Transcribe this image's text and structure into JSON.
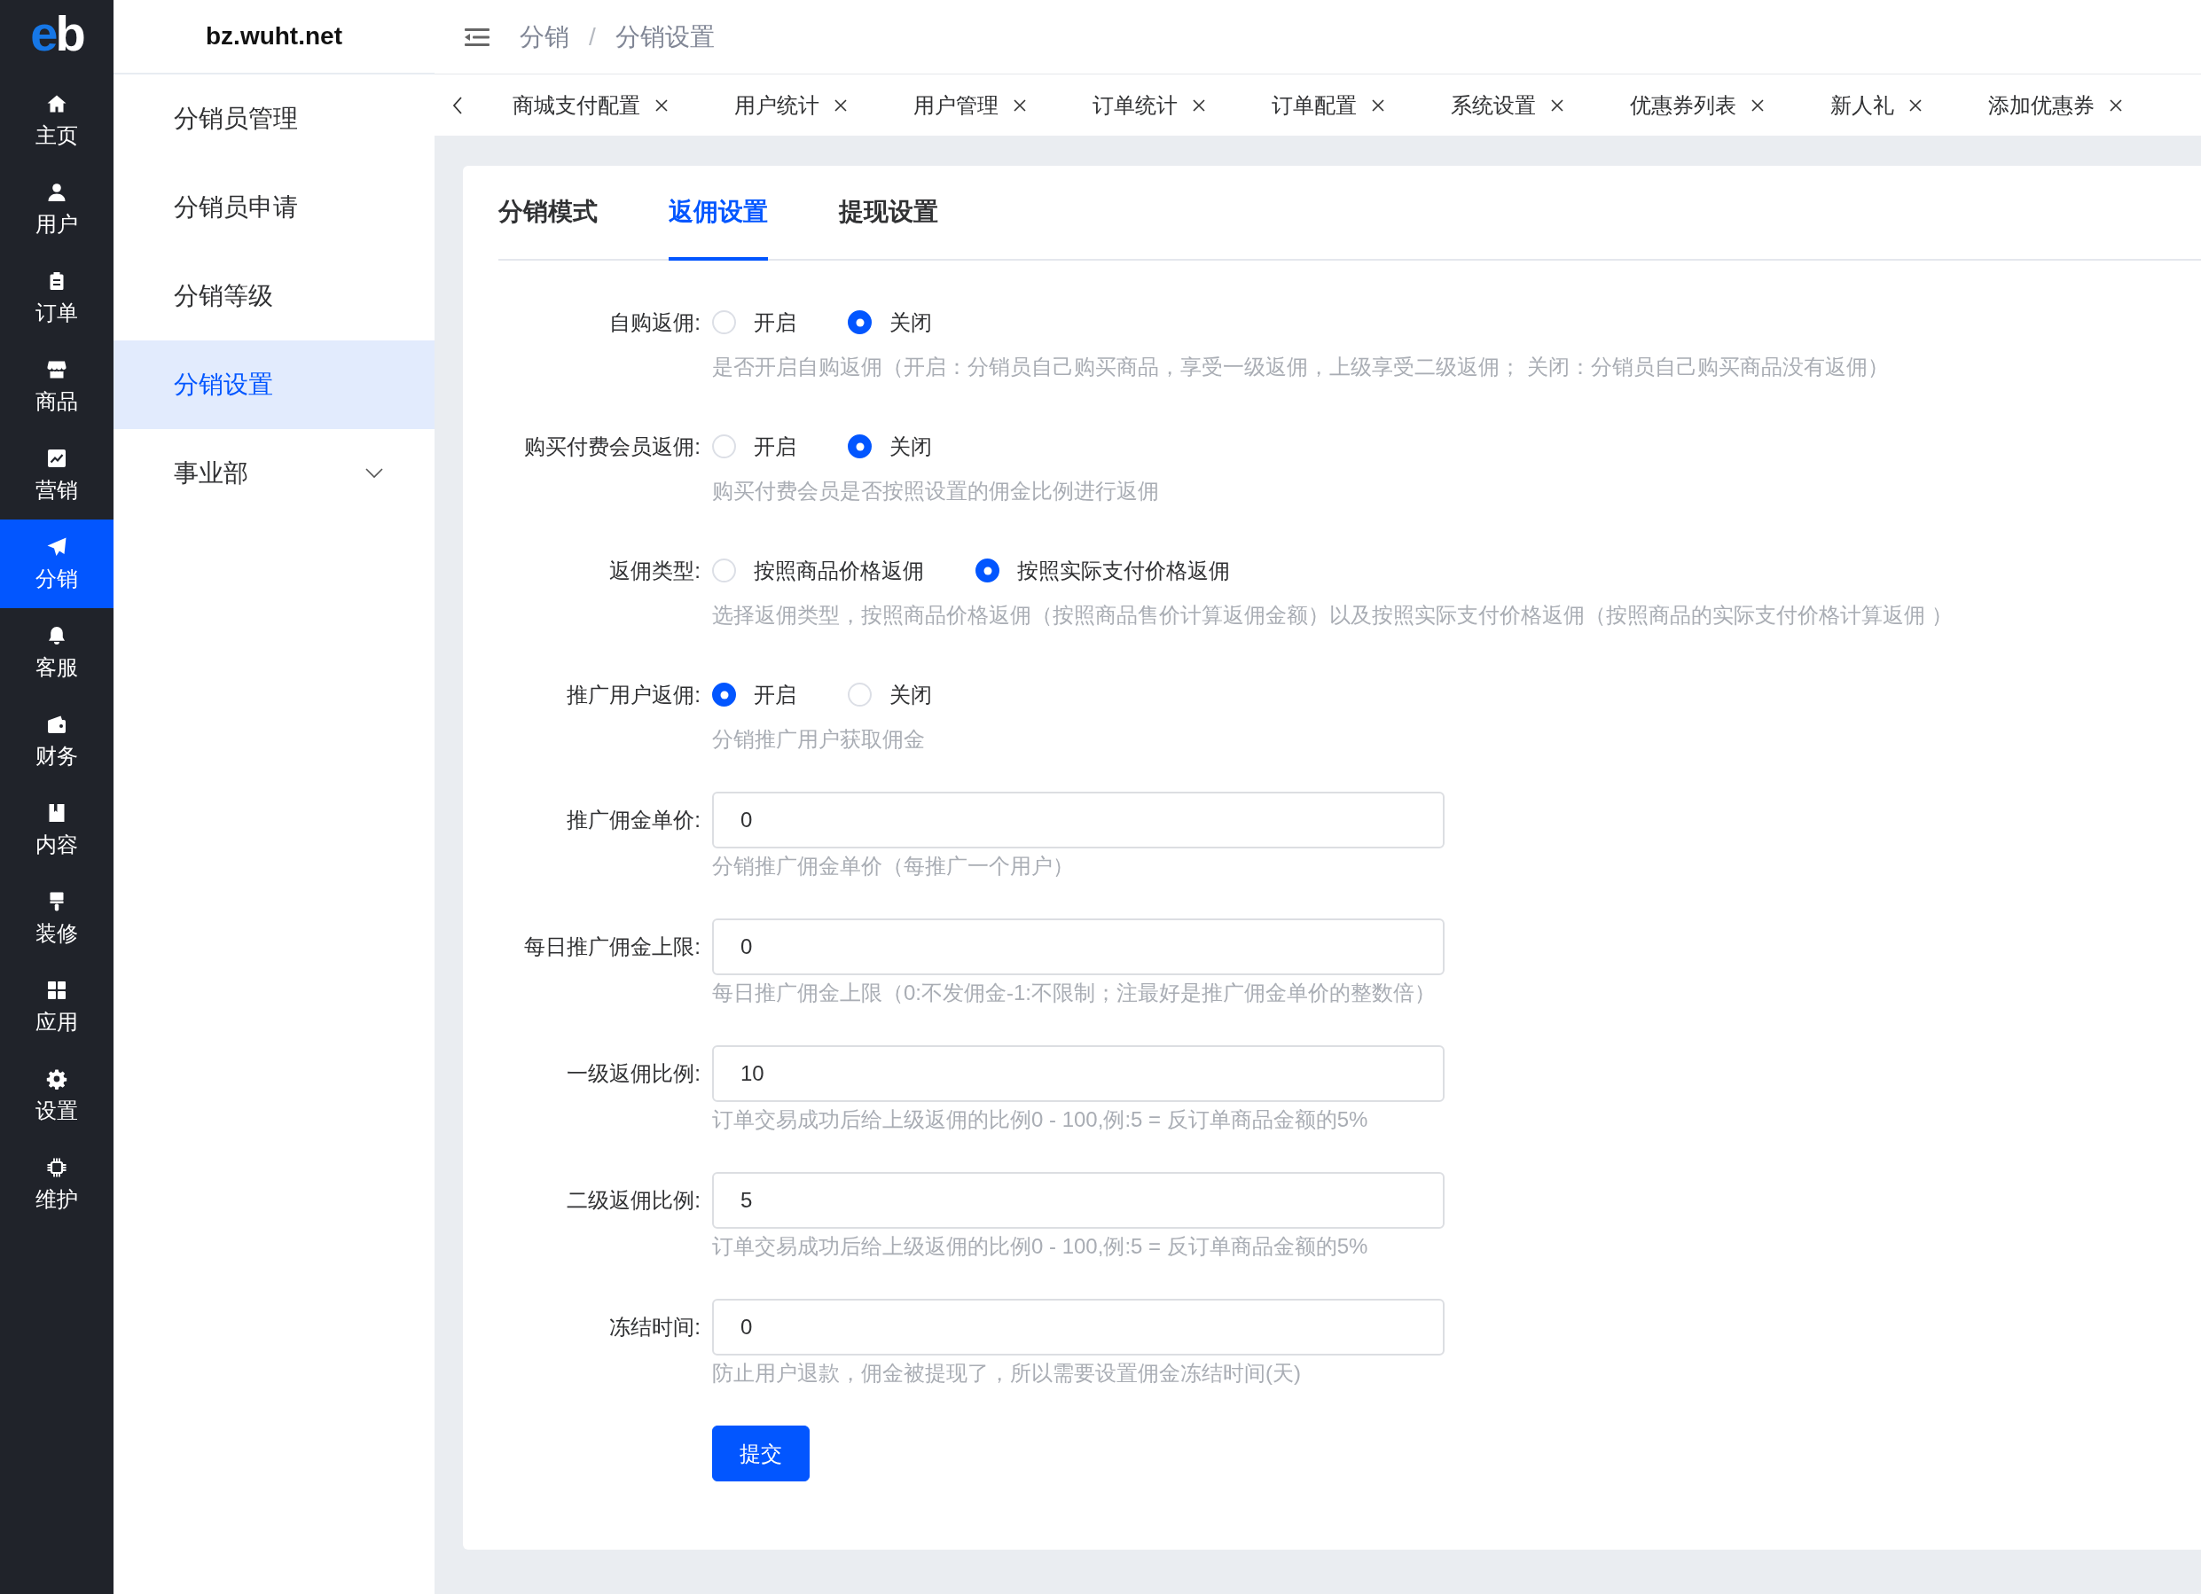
{
  "nav_rail": {
    "logo": "eb",
    "items": [
      {
        "label": "主页",
        "selected": false
      },
      {
        "label": "用户",
        "selected": false
      },
      {
        "label": "订单",
        "selected": false
      },
      {
        "label": "商品",
        "selected": false
      },
      {
        "label": "营销",
        "selected": false
      },
      {
        "label": "分销",
        "selected": true
      },
      {
        "label": "客服",
        "selected": false
      },
      {
        "label": "财务",
        "selected": false
      },
      {
        "label": "内容",
        "selected": false
      },
      {
        "label": "装修",
        "selected": false
      },
      {
        "label": "应用",
        "selected": false
      },
      {
        "label": "设置",
        "selected": false
      },
      {
        "label": "维护",
        "selected": false
      }
    ]
  },
  "submenu": {
    "title": "bz.wuht.net",
    "items": [
      {
        "kind": "link",
        "label": "分销员管理",
        "selected": false
      },
      {
        "kind": "link",
        "label": "分销员申请",
        "selected": false
      },
      {
        "kind": "link",
        "label": "分销等级",
        "selected": false
      },
      {
        "kind": "link",
        "label": "分销设置",
        "selected": true
      },
      {
        "kind": "group",
        "label": "事业部",
        "selected": false,
        "expanded": false
      }
    ]
  },
  "header": {
    "breadcrumb": [
      "分销",
      "分销设置"
    ],
    "separator": "/"
  },
  "page_tabs": [
    {
      "label": "商城支付配置",
      "selected": false
    },
    {
      "label": "用户统计",
      "selected": false
    },
    {
      "label": "用户管理",
      "selected": false
    },
    {
      "label": "订单统计",
      "selected": false
    },
    {
      "label": "订单配置",
      "selected": false
    },
    {
      "label": "系统设置",
      "selected": false
    },
    {
      "label": "优惠券列表",
      "selected": false
    },
    {
      "label": "新人礼",
      "selected": false
    },
    {
      "label": "添加优惠券",
      "selected": false
    }
  ],
  "settings_tabs": [
    {
      "label": "分销模式",
      "selected": false
    },
    {
      "label": "返佣设置",
      "selected": true
    },
    {
      "label": "提现设置",
      "selected": false
    }
  ],
  "form": {
    "fields": [
      {
        "kind": "radio",
        "label": "自购返佣:",
        "options": [
          {
            "label": "开启",
            "selected": false
          },
          {
            "label": "关闭",
            "selected": true
          }
        ],
        "hint": "是否开启自购返佣（开启：分销员自己购买商品，享受一级返佣，上级享受二级返佣； 关闭：分销员自己购买商品没有返佣）"
      },
      {
        "kind": "radio",
        "label": "购买付费会员返佣:",
        "options": [
          {
            "label": "开启",
            "selected": false
          },
          {
            "label": "关闭",
            "selected": true
          }
        ],
        "hint": "购买付费会员是否按照设置的佣金比例进行返佣"
      },
      {
        "kind": "radio",
        "label": "返佣类型:",
        "options": [
          {
            "label": "按照商品价格返佣",
            "selected": false
          },
          {
            "label": "按照实际支付价格返佣",
            "selected": true
          }
        ],
        "hint": "选择返佣类型，按照商品价格返佣（按照商品售价计算返佣金额）以及按照实际支付价格返佣（按照商品的实际支付价格计算返佣 ）"
      },
      {
        "kind": "radio",
        "label": "推广用户返佣:",
        "options": [
          {
            "label": "开启",
            "selected": true
          },
          {
            "label": "关闭",
            "selected": false
          }
        ],
        "hint": "分销推广用户获取佣金"
      },
      {
        "kind": "input",
        "label": "推广佣金单价:",
        "value": "0",
        "hint": "分销推广佣金单价（每推广一个用户）"
      },
      {
        "kind": "input",
        "label": "每日推广佣金上限:",
        "value": "0",
        "hint": "每日推广佣金上限（0:不发佣金-1:不限制；注最好是推广佣金单价的整数倍）"
      },
      {
        "kind": "input",
        "label": "一级返佣比例:",
        "value": "10",
        "hint": "订单交易成功后给上级返佣的比例0 - 100,例:5 = 反订单商品金额的5%"
      },
      {
        "kind": "input",
        "label": "二级返佣比例:",
        "value": "5",
        "hint": "订单交易成功后给上级返佣的比例0 - 100,例:5 = 反订单商品金额的5%"
      },
      {
        "kind": "input",
        "label": "冻结时间:",
        "value": "0",
        "hint": "防止用户退款，佣金被提现了，所以需要设置佣金冻结时间(天)"
      }
    ],
    "submit": "提交"
  }
}
